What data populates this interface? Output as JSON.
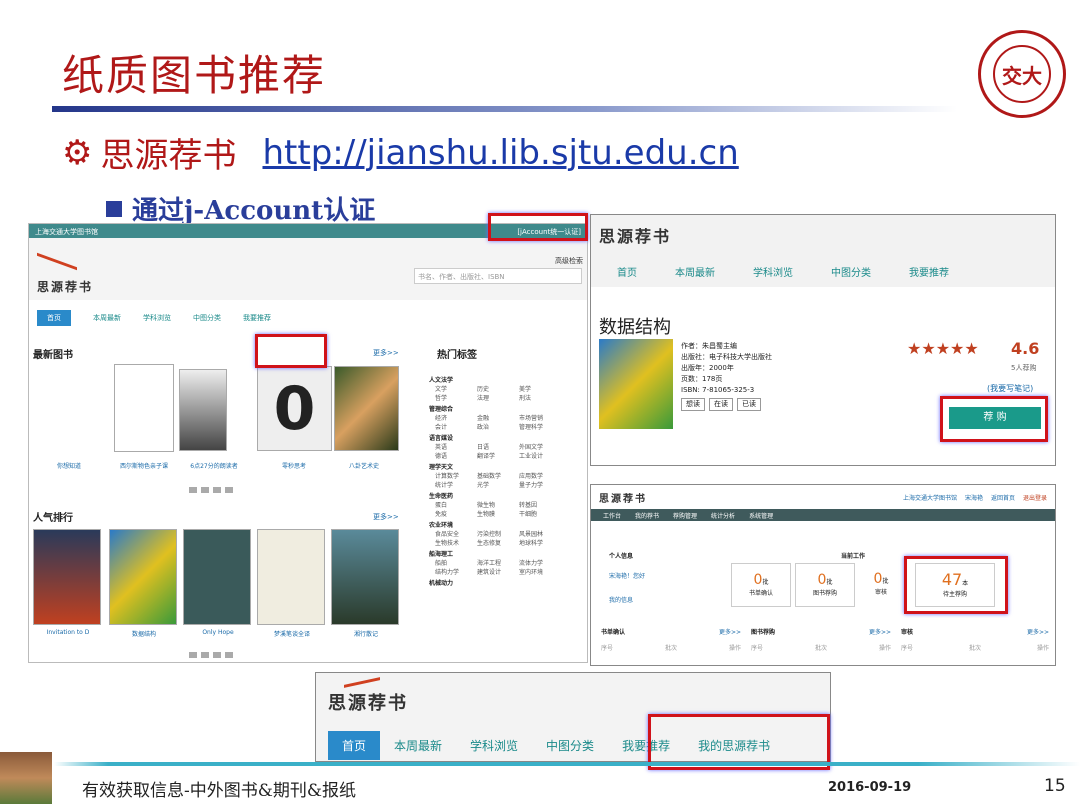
{
  "slide": {
    "title": "纸质图书推荐",
    "heading": "思源荐书",
    "url": "http://jianshu.lib.sjtu.edu.cn",
    "bullet": "通过j-Account认证",
    "footer": "有效获取信息-中外图书&期刊&报纸",
    "date": "2016-09-19",
    "page": "15",
    "logo_text": "交大"
  },
  "main": {
    "site": "上海交通大学图书馆",
    "login": "[jAccount统一认证]",
    "adv_search": "高级检索",
    "search_placeholder": "书名、作者、出版社、ISBN",
    "brand": "思源荐书",
    "nav": [
      "首页",
      "本周最新",
      "学科浏览",
      "中图分类",
      "我要推荐"
    ],
    "latest": "最新图书",
    "more": "更多>>",
    "popular": "人气排行",
    "latest_books": [
      "你想知道",
      "西尔斯物色亲子课",
      "6点27分的朗读者",
      "零秒思考",
      "八卦艺术史"
    ],
    "popular_books": [
      "Invitation to D",
      "数据结构",
      "Only Hope",
      "梦溪笔谈全译",
      "湘行散记"
    ],
    "hot_tags": "热门标签",
    "tags": [
      {
        "cat": "人文法学",
        "items": [
          "文学",
          "历史",
          "美学",
          "哲学",
          "法理",
          "刑法"
        ]
      },
      {
        "cat": "管理综合",
        "items": [
          "经济",
          "金融",
          "市场营销",
          "会计",
          "政治",
          "管理科学"
        ]
      },
      {
        "cat": "语言媒设",
        "items": [
          "英语",
          "日语",
          "外国文学",
          "德语",
          "翻译学",
          "工业设计"
        ]
      },
      {
        "cat": "理学天文",
        "items": [
          "计算数学",
          "基础数学",
          "应用数学",
          "统计学",
          "光学",
          "量子力学"
        ]
      },
      {
        "cat": "生命医药",
        "items": [
          "蛋白",
          "微生物",
          "转基因",
          "免疫",
          "生物膜",
          "干细胞"
        ]
      },
      {
        "cat": "农业环境",
        "items": [
          "食品安全",
          "污染控制",
          "风景园林",
          "生物技术",
          "生态修复",
          "地球科学"
        ]
      },
      {
        "cat": "船海理工",
        "items": [
          "船舶",
          "海洋工程",
          "流体力学",
          "结构力学",
          "建筑设计",
          "室内环境"
        ]
      },
      {
        "cat": "机械动力",
        "items": []
      }
    ]
  },
  "detail": {
    "brand": "思源荐书",
    "nav": [
      "首页",
      "本周最新",
      "学科浏览",
      "中图分类",
      "我要推荐"
    ],
    "book": "数据结构",
    "author": "作者：朱昌蜀主编",
    "publisher": "出版社：电子科技大学出版社",
    "year": "出版年：2000年",
    "pages": "页数：178页",
    "isbn": "ISBN: 7-81065-325-3",
    "want": "想读",
    "reading": "在读",
    "read": "已读",
    "rating": "4.6",
    "stars": "★★★★★",
    "votes": "5人荐购",
    "review": "(我要写笔记)",
    "buy": "荐 购"
  },
  "admin": {
    "brand": "思源荐书",
    "top": [
      "上海交通大学图书馆",
      "宋海艳",
      "返回首页",
      "退出登录"
    ],
    "tabs": [
      "工作台",
      "我的荐书",
      "荐购管理",
      "统计分析",
      "系统管理"
    ],
    "personal": "个人信息",
    "workbench": "当前工作",
    "user": "宋海艳！您好",
    "myinfo": "我的信息",
    "stats": [
      {
        "v": "0",
        "u": "批",
        "l": "书单确认"
      },
      {
        "v": "0",
        "u": "批",
        "l": "图书荐购"
      },
      {
        "v": "0",
        "u": "批",
        "l": "审核"
      },
      {
        "v": "47",
        "u": "本",
        "l": "待主荐购"
      }
    ],
    "panels": [
      "书单确认",
      "图书荐购",
      "审核"
    ],
    "more": "更多>>",
    "cols": [
      "序号",
      "批次",
      "操作"
    ]
  },
  "bottom": {
    "brand": "思源荐书",
    "nav": [
      "首页",
      "本周最新",
      "学科浏览",
      "中图分类",
      "我要推荐",
      "我的思源荐书"
    ]
  },
  "colors": {
    "red": "#b01818",
    "blue": "#2a3e9a",
    "teal": "#1a8a8a"
  }
}
